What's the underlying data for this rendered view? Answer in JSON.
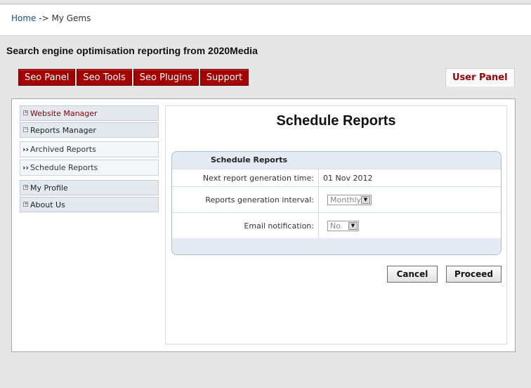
{
  "breadcrumb": {
    "home": "Home",
    "separator": " -> ",
    "current": "My Gems"
  },
  "site_title": "Search engine optimisation reporting from 2020Media",
  "tabs": [
    {
      "label": "Seo Panel"
    },
    {
      "label": "Seo Tools"
    },
    {
      "label": "Seo Plugins"
    },
    {
      "label": "Support"
    }
  ],
  "user_tab": "User Panel",
  "menu": {
    "website_manager": "Website Manager",
    "reports_manager": "Reports Manager",
    "archived_reports": "Archived Reports",
    "schedule_reports": "Schedule Reports",
    "my_profile": "My Profile",
    "about_us": "About Us"
  },
  "icons": {
    "plus": "+",
    "minus": "−",
    "arrows": "››",
    "dropdown": "▼"
  },
  "content": {
    "title": "Schedule Reports",
    "panel_title": "Schedule Reports",
    "rows": [
      {
        "label": "Next report generation time:",
        "value": "01 Nov 2012"
      },
      {
        "label": "Reports generation interval:",
        "value": "Monthly"
      },
      {
        "label": "Email notification:",
        "value": "No"
      }
    ]
  },
  "buttons": {
    "cancel": "Cancel",
    "proceed": "Proceed"
  },
  "colors": {
    "accent": "#a50000",
    "user_panel_text": "#9a0000",
    "link": "#1d4f8c"
  }
}
